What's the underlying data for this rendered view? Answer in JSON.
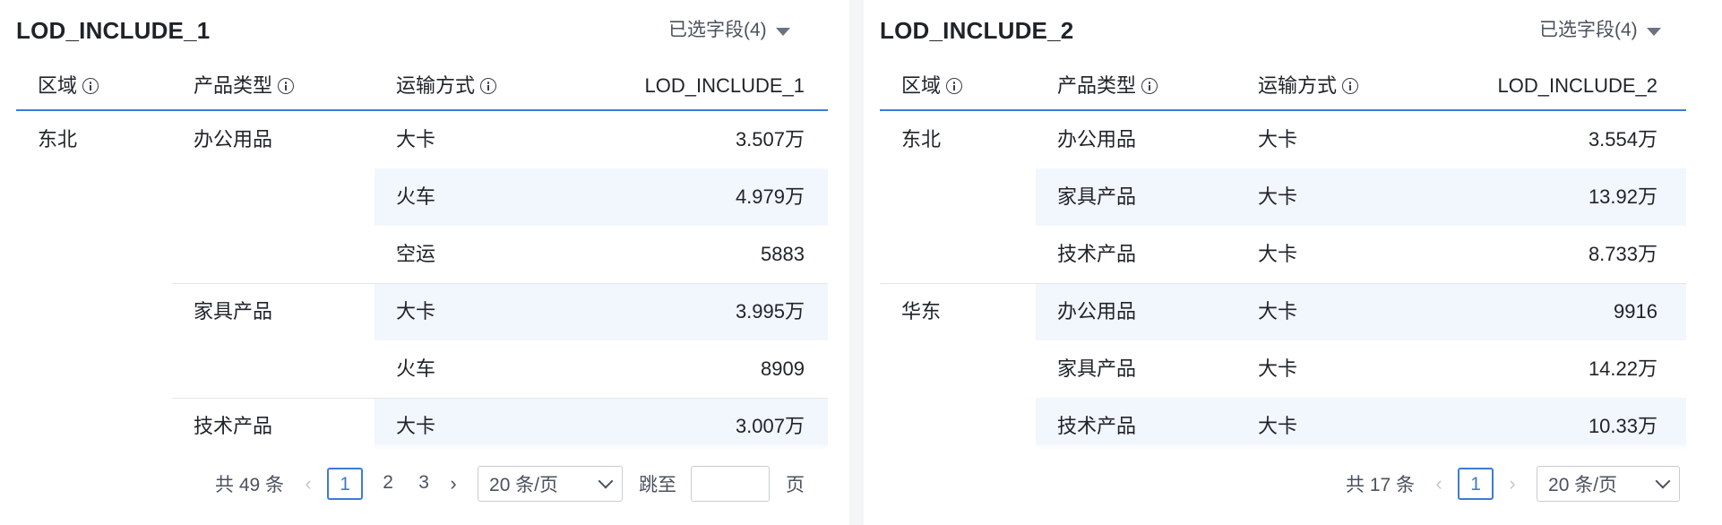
{
  "panels": [
    {
      "title": "LOD_INCLUDE_1",
      "field_selector": "已选字段(4)",
      "columns": [
        "区域",
        "产品类型",
        "运输方式",
        "LOD_INCLUDE_1"
      ],
      "rows": [
        {
          "region": "东北",
          "product": "办公用品",
          "transport": "大卡",
          "value": "3.507万"
        },
        {
          "region": "",
          "product": "",
          "transport": "火车",
          "value": "4.979万"
        },
        {
          "region": "",
          "product": "",
          "transport": "空运",
          "value": "5883"
        },
        {
          "region": "",
          "product": "家具产品",
          "transport": "大卡",
          "value": "3.995万"
        },
        {
          "region": "",
          "product": "",
          "transport": "火车",
          "value": "8909"
        },
        {
          "region": "",
          "product": "技术产品",
          "transport": "大卡",
          "value": "3.007万"
        }
      ],
      "pagination": {
        "total": "共 49 条",
        "pages": [
          "1",
          "2",
          "3"
        ],
        "current": "1",
        "page_size": "20 条/页",
        "jump_label": "跳至",
        "jump_value": "",
        "page_unit": "页"
      }
    },
    {
      "title": "LOD_INCLUDE_2",
      "field_selector": "已选字段(4)",
      "columns": [
        "区域",
        "产品类型",
        "运输方式",
        "LOD_INCLUDE_2"
      ],
      "rows": [
        {
          "region": "东北",
          "product": "办公用品",
          "transport": "大卡",
          "value": "3.554万"
        },
        {
          "region": "",
          "product": "家具产品",
          "transport": "大卡",
          "value": "13.92万"
        },
        {
          "region": "",
          "product": "技术产品",
          "transport": "大卡",
          "value": "8.733万"
        },
        {
          "region": "华东",
          "product": "办公用品",
          "transport": "大卡",
          "value": "9916"
        },
        {
          "region": "",
          "product": "家具产品",
          "transport": "大卡",
          "value": "14.22万"
        },
        {
          "region": "",
          "product": "技术产品",
          "transport": "大卡",
          "value": "10.33万"
        }
      ],
      "pagination": {
        "total": "共 17 条",
        "pages": [
          "1"
        ],
        "current": "1",
        "page_size": "20 条/页"
      }
    }
  ],
  "icons": {
    "column_info": "info-circle-icon",
    "field_caret": "caret-down-icon",
    "prev": "chevron-left-icon",
    "next": "chevron-right-icon",
    "size_dropdown": "chevron-down-icon"
  },
  "colors": {
    "accent": "#3d7bd6",
    "stripe": "#f2f6fd",
    "gap": "#f4f5f7"
  }
}
